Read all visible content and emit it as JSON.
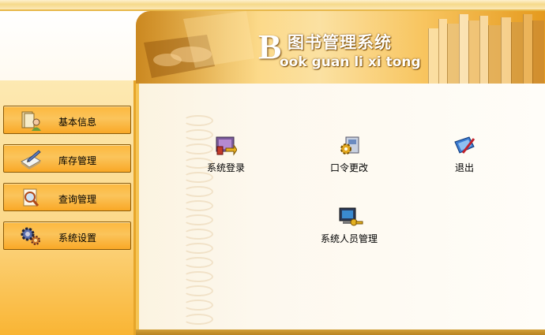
{
  "app": {
    "title_zh": "图书管理系统",
    "title_initial": "B",
    "title_en": "ook guan li xi tong"
  },
  "sidebar": {
    "items": [
      {
        "label": "基本信息",
        "icon": "book-user-icon"
      },
      {
        "label": "库存管理",
        "icon": "notepad-pen-icon"
      },
      {
        "label": "查询管理",
        "icon": "search-document-icon"
      },
      {
        "label": "系统设置",
        "icon": "gears-icon"
      }
    ]
  },
  "main": {
    "actions": [
      {
        "label": "系统登录",
        "icon": "login-icon"
      },
      {
        "label": "口令更改",
        "icon": "password-change-icon"
      },
      {
        "label": "退出",
        "icon": "exit-icon"
      },
      {
        "label": "系统人员管理",
        "icon": "computer-key-icon"
      }
    ]
  },
  "colors": {
    "accent": "#f9b534",
    "menu_border": "#8a5a08",
    "banner_gold": "#fcd57c"
  }
}
